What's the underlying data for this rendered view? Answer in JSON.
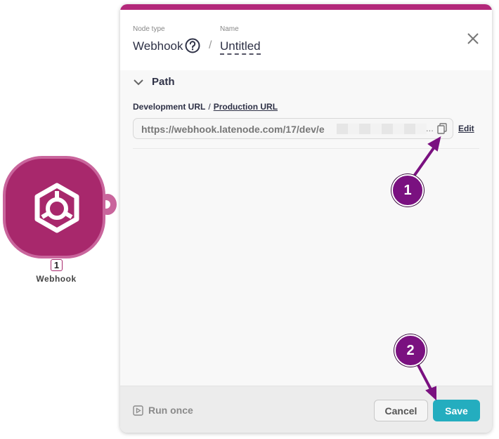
{
  "canvas": {
    "node": {
      "number": "1",
      "label": "Webhook",
      "icon": "webhook-hexagon-icon",
      "color": "#a8286c"
    }
  },
  "panel": {
    "accent_color": "#b3287a",
    "header": {
      "node_type_label": "Node type",
      "node_type": "Webhook",
      "name_label": "Name",
      "name": "Untitled",
      "separator": "/"
    },
    "section": {
      "title": "Path"
    },
    "url": {
      "dev_label": "Development URL",
      "slash": "/",
      "prod_label": "Production URL",
      "value": "https://webhook.latenode.com/17/dev/e",
      "ellipsis": "...",
      "edit_label": "Edit"
    },
    "footer": {
      "run_once": "Run once",
      "cancel": "Cancel",
      "save": "Save",
      "save_color": "#24adbf"
    }
  },
  "annotations": {
    "badge_1": "1",
    "badge_2": "2",
    "color": "#7a1180"
  }
}
